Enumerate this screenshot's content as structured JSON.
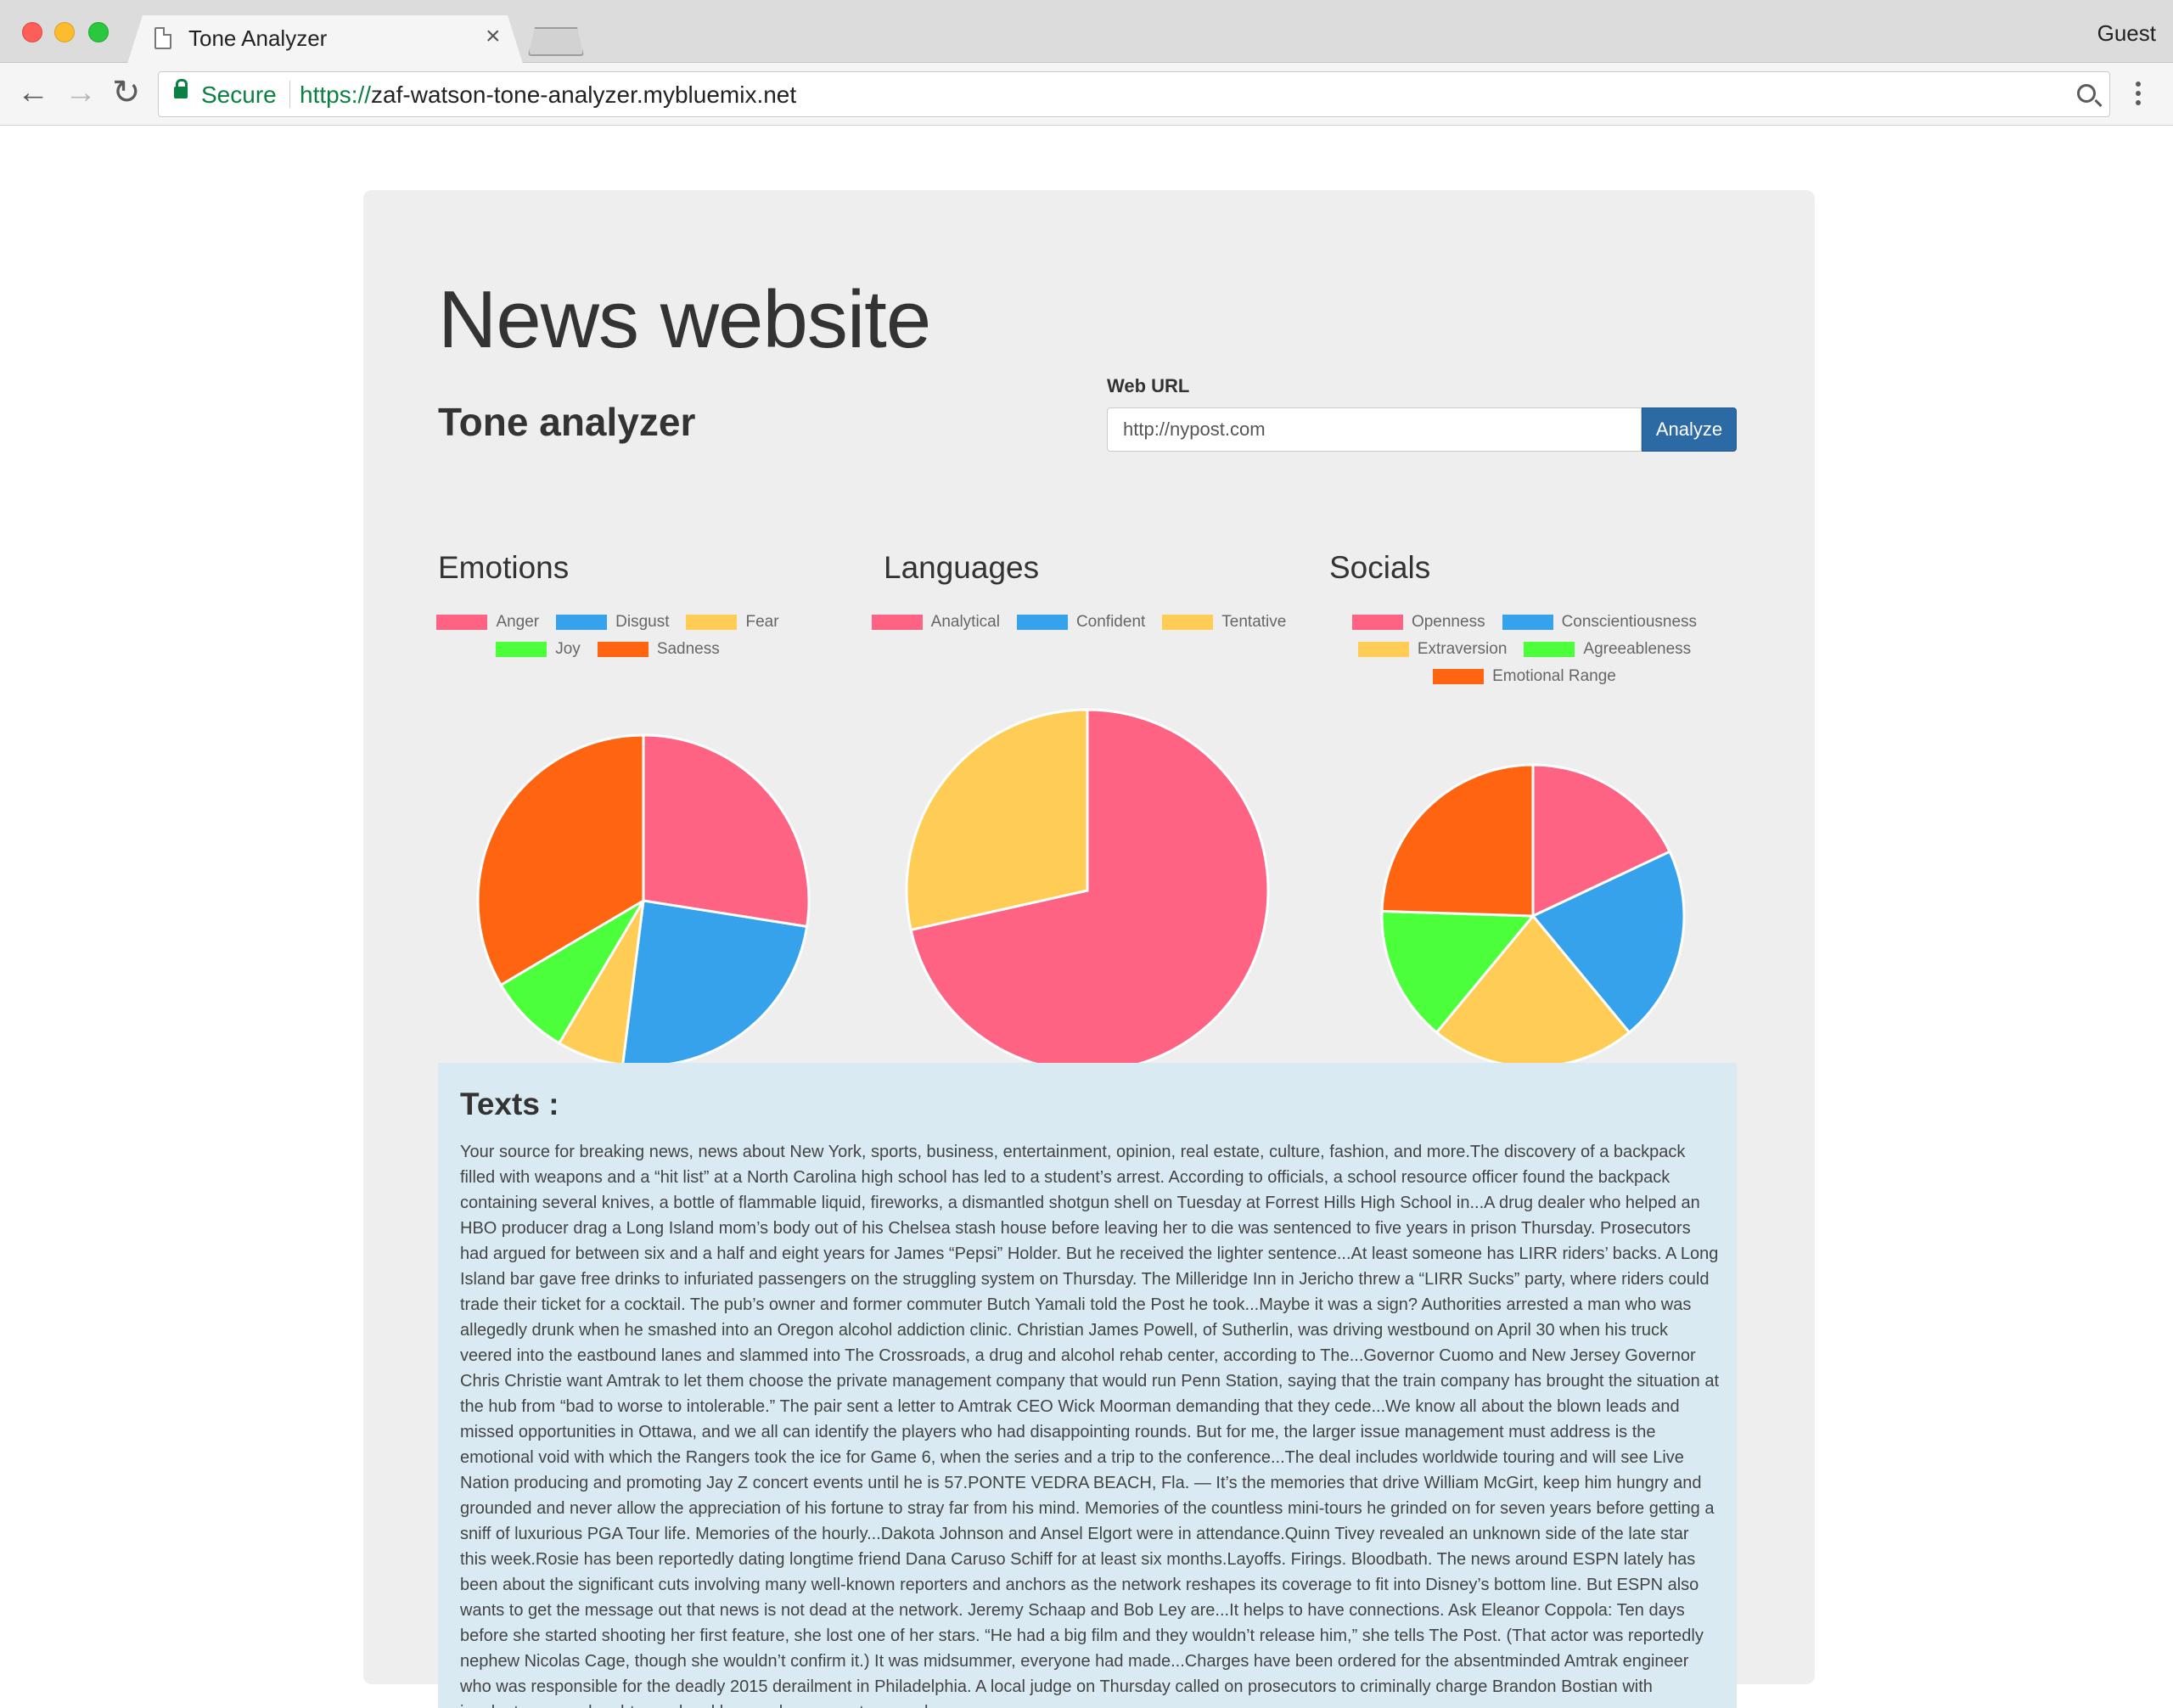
{
  "browser": {
    "tab_title": "Tone Analyzer",
    "tab_close_glyph": "×",
    "profile_label": "Guest",
    "secure_label": "Secure",
    "url_scheme": "https://",
    "url_host": "zaf-watson-tone-analyzer.mybluemix.net",
    "nav": {
      "back": "←",
      "forward": "→",
      "reload": "↻"
    }
  },
  "header": {
    "title": "News website",
    "subtitle": "Tone analyzer"
  },
  "form": {
    "label": "Web URL",
    "url_value": "http://nypost.com",
    "button_label": "Analyze"
  },
  "chart_data": [
    {
      "type": "pie",
      "title": "Emotions",
      "categories": [
        "Anger",
        "Disgust",
        "Fear",
        "Joy",
        "Sadness"
      ],
      "values": [
        27.5,
        24.5,
        6.5,
        8.0,
        33.5
      ],
      "colors": [
        "#ff6384",
        "#36a2eb",
        "#ffcd56",
        "#4bff3b",
        "#ff6410"
      ],
      "legend": "top"
    },
    {
      "type": "pie",
      "title": "Languages",
      "categories": [
        "Analytical",
        "Confident",
        "Tentative"
      ],
      "values": [
        71.5,
        0.0,
        28.5
      ],
      "colors": [
        "#ff6384",
        "#36a2eb",
        "#ffcd56"
      ],
      "legend": "top"
    },
    {
      "type": "pie",
      "title": "Socials",
      "categories": [
        "Openness",
        "Conscientiousness",
        "Extraversion",
        "Agreeableness",
        "Emotional Range"
      ],
      "values": [
        18.0,
        21.0,
        22.0,
        14.5,
        24.5
      ],
      "colors": [
        "#ff6384",
        "#36a2eb",
        "#ffcd56",
        "#4bff3b",
        "#ff6410"
      ],
      "legend": "top"
    }
  ],
  "texts": {
    "title": "Texts :",
    "body": "Your source for breaking news, news about New York, sports, business, entertainment, opinion, real estate, culture, fashion, and more.The discovery of a backpack filled with weapons and a “hit list” at a North Carolina high school has led to a student’s arrest. According to officials, a school resource officer found the backpack containing several knives, a bottle of flammable liquid, fireworks, a dismantled shotgun shell on Tuesday at Forrest Hills High School in...A drug dealer who helped an HBO producer drag a Long Island mom’s body out of his Chelsea stash house before leaving her to die was sentenced to five years in prison Thursday. Prosecutors had argued for between six and a half and eight years for James “Pepsi” Holder. But he received the lighter sentence...At least someone has LIRR riders’ backs. A Long Island bar gave free drinks to infuriated passengers on the struggling system on Thursday. The Milleridge Inn in Jericho threw a “LIRR Sucks” party, where riders could trade their ticket for a cocktail. The pub’s owner and former commuter Butch Yamali told the Post he took...Maybe it was a sign? Authorities arrested a man who was allegedly drunk when he smashed into an Oregon alcohol addiction clinic. Christian James Powell, of Sutherlin, was driving westbound on April 30 when his truck veered into the eastbound lanes and slammed into The Crossroads, a drug and alcohol rehab center, according to The...Governor Cuomo and New Jersey Governor Chris Christie want Amtrak to let them choose the private management company that would run Penn Station, saying that the train company has brought the situation at the hub from “bad to worse to intolerable.” The pair sent a letter to Amtrak CEO Wick Moorman demanding that they cede...We know all about the blown leads and missed opportunities in Ottawa, and we all can identify the players who had disappointing rounds. But for me, the larger issue management must address is the emotional void with which the Rangers took the ice for Game 6, when the series and a trip to the conference...The deal includes worldwide touring and will see Live Nation producing and promoting Jay Z concert events until he is 57.PONTE VEDRA BEACH, Fla. — It’s the memories that drive William McGirt, keep him hungry and grounded and never allow the appreciation of his fortune to stray far from his mind. Memories of the countless mini-tours he grinded on for seven years before getting a sniff of luxurious PGA Tour life. Memories of the hourly...Dakota Johnson and Ansel Elgort were in attendance.Quinn Tivey revealed an unknown side of the late star this week.Rosie has been reportedly dating longtime friend Dana Caruso Schiff for at least six months.Layoffs. Firings. Bloodbath. The news around ESPN lately has been about the significant cuts involving many well-known reporters and anchors as the network reshapes its coverage to fit into Disney’s bottom line. But ESPN also wants to get the message out that news is not dead at the network. Jeremy Schaap and Bob Ley are...It helps to have connections. Ask Eleanor Coppola: Ten days before she started shooting her first feature, she lost one of her stars. “He had a big film and they wouldn’t release him,” she tells The Post. (That actor was reportedly nephew Nicolas Cage, though she wouldn’t confirm it.) It was midsummer, everyone had made...Charges have been ordered for the absentminded Amtrak engineer who was responsible for the deadly 2015 derailment in Philadelphia. A local judge on Thursday called on prosecutors to criminally charge Brandon Bostian with involuntary manslaughter and reckless endangerment — nearly"
  }
}
